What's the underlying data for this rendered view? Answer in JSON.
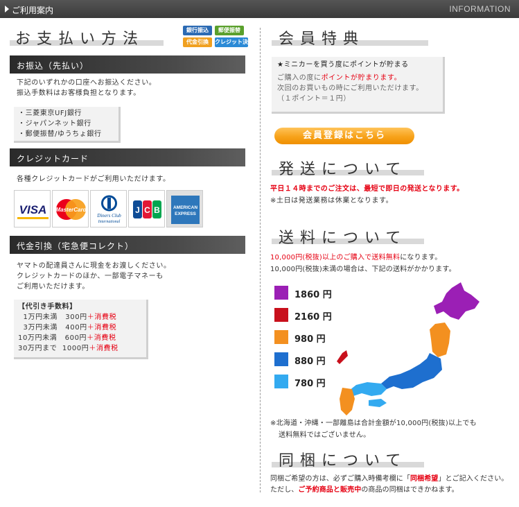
{
  "header": {
    "title": "ご利用案内",
    "info": "INFORMATION"
  },
  "payment": {
    "title": "お支払い方法",
    "badges": [
      {
        "label": "銀行振込",
        "color": "#2b6ab3"
      },
      {
        "label": "郵便振替",
        "color": "#5aa02c"
      },
      {
        "label": "代金引換",
        "color": "#f0a020"
      },
      {
        "label": "クレジット決済",
        "color": "#2b8ad6"
      }
    ],
    "transfer": {
      "heading": "お振込（先払い）",
      "text1": "下記のいずれかの口座へお振込ください。",
      "text2": "振込手数料はお客様負担となります。",
      "banks": [
        "・三菱東京UFJ銀行",
        "・ジャパンネット銀行",
        "・郵便振替/ゆうちょ銀行"
      ]
    },
    "credit": {
      "heading": "クレジットカード",
      "text": "各種クレジットカードがご利用いただけます。",
      "cards": [
        "VISA",
        "MasterCard",
        "Diners Club International",
        "JCB",
        "AMERICAN EXPRESS"
      ]
    },
    "cod": {
      "heading": "代金引換（宅急便コレクト）",
      "text1": "ヤマトの配達員さんに現金をお渡しください。",
      "text2": "クレジットカードのほか、一部電子マネーも",
      "text3": "ご利用いただけます。",
      "fee_title": "【代引き手数料】",
      "fees": [
        {
          "range": "  1万円未満",
          "amount": "300円",
          "tax": "＋消費税"
        },
        {
          "range": "  3万円未満",
          "amount": "400円",
          "tax": "＋消費税"
        },
        {
          "range": "10万円未満",
          "amount": "600円",
          "tax": "＋消費税"
        },
        {
          "range": "30万円まで",
          "amount": "1000円",
          "tax": "＋消費税"
        }
      ]
    }
  },
  "member": {
    "title": "会員特典",
    "line1": "★ミニカーを買う度にポイントが貯まる",
    "line2a": "ご購入の度に",
    "line2b": "ポイントが貯まります。",
    "line3": "次回のお買いもの時にご利用いただけます。",
    "line4": "（１ポイント＝１円）",
    "register_button": "会員登録はこちら"
  },
  "shipping": {
    "title": "発送について",
    "note_red": "平日１４時までのご注文は、最短で即日の発送となります。",
    "note": "※土日は発送業務は休業となります。"
  },
  "fee": {
    "title": "送料について",
    "line1_red": "10,000円(税抜)以上のご購入で送料無料",
    "line1_rest": "になります。",
    "line2": "10,000円(税抜)未満の場合は、下記の送料がかかります。",
    "legend": [
      {
        "label": "1860 円",
        "color": "#9b1fb5"
      },
      {
        "label": "2160 円",
        "color": "#c8101c"
      },
      {
        "label": "980 円",
        "color": "#f39020"
      },
      {
        "label": "880 円",
        "color": "#1e6fcf"
      },
      {
        "label": "780 円",
        "color": "#33aaf0"
      }
    ],
    "footnote1": "※北海道・沖縄・一部離島は合計金額が10,000円(税抜)以上でも",
    "footnote2": "送料無料ではございません。"
  },
  "bundle": {
    "title": "同梱について",
    "line1a": "同梱ご希望の方は、必ずご購入時備考欄に「",
    "line1b": "同梱希望",
    "line1c": "」とご記入ください。",
    "line2a": "ただし、",
    "line2b": "ご予約商品と販売中",
    "line2c": "の商品の同梱はできかねます。"
  }
}
